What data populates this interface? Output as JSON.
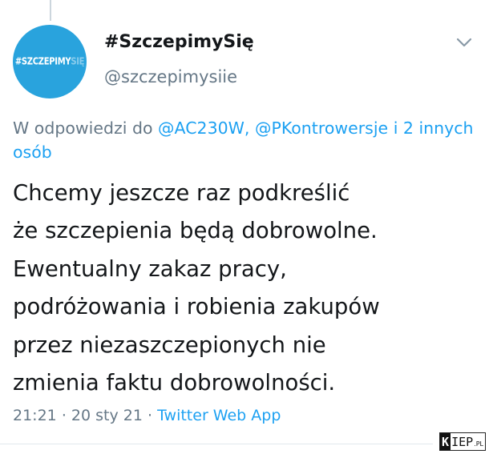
{
  "tweet": {
    "author": {
      "display_name": "#SzczepimySię",
      "handle": "@szczepimysiie",
      "avatar": {
        "text_main": "#SZCZEPIMY",
        "text_faded": "SIĘ",
        "color": "#29a3dd"
      }
    },
    "reply": {
      "prefix": "W odpowiedzi do",
      "mention_1": "@AC230W,",
      "mention_2": "@PKontrowersje",
      "others": "i 2 innych osób"
    },
    "text": "Chcemy jeszcze raz podkreślić\nże szczepienia będą dobrowolne.\nEwentualny zakaz pracy,\npodróżowania i robienia zakupów\nprzez niezaszczepionych nie\nzmienia faktu dobrowolności.",
    "time": "21:21",
    "date": "20 sty 21",
    "separator": "·",
    "source": "Twitter Web App",
    "menu_icon": "chevron-down-icon"
  },
  "watermark": {
    "k": "K",
    "rest": "IEP",
    "tld": ".PL"
  },
  "colors": {
    "link": "#1da1f2",
    "secondary_text": "#657786",
    "primary_text": "#14171a",
    "divider": "#e1e8ed"
  }
}
